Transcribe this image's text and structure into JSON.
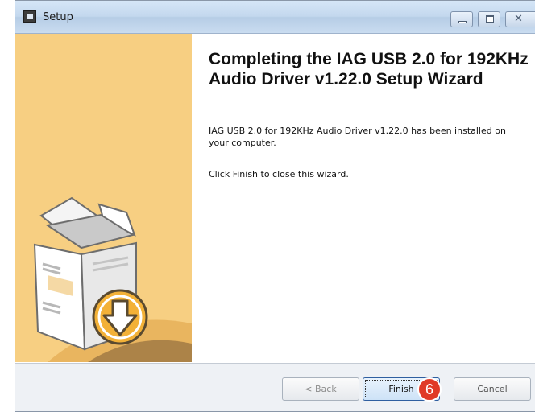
{
  "window": {
    "title": "Setup",
    "controls": {
      "minimize": "minimize-icon",
      "maximize": "maximize-icon",
      "close": "close-icon"
    }
  },
  "sidebar": {
    "illustration": "box-with-download-arrow-icon"
  },
  "content": {
    "heading": "Completing the IAG USB 2.0 for 192KHz Audio Driver v1.22.0 Setup Wizard",
    "installed_text": "IAG USB 2.0 for 192KHz Audio Driver v1.22.0 has been installed on your computer.",
    "instruction_text": "Click Finish to close this wizard."
  },
  "footer": {
    "back_label": "< Back",
    "finish_label": "Finish",
    "cancel_label": "Cancel",
    "step_badge": "6"
  },
  "colors": {
    "sidebar": "#f7cf82",
    "badge": "#e03a27",
    "accent": "#2f5fa0"
  }
}
